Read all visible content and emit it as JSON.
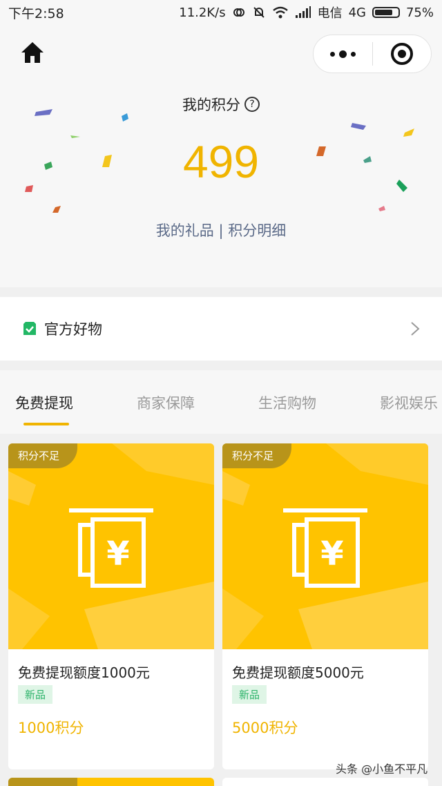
{
  "status_bar": {
    "time": "下午2:58",
    "speed": "11.2K/s",
    "carrier": "电信",
    "network": "4G",
    "battery": "75%"
  },
  "header": {
    "home_icon": "home-icon",
    "more_icon": "more-dots-icon",
    "close_icon": "target-circle-icon",
    "points_title": "我的积分",
    "points_value": "499",
    "links": {
      "gifts": "我的礼品",
      "separator": "|",
      "details": "积分明细"
    }
  },
  "official": {
    "label": "官方好物",
    "icon": "green-bag-icon",
    "chevron": "chevron-right-icon"
  },
  "tabs": [
    {
      "label": "免费提现",
      "active": true
    },
    {
      "label": "商家保障",
      "active": false
    },
    {
      "label": "生活购物",
      "active": false
    },
    {
      "label": "影视娱乐",
      "active": false
    }
  ],
  "cards": [
    {
      "badge": "积分不足",
      "title": "免费提现额度1000元",
      "tag": "新品",
      "price": "1000积分"
    },
    {
      "badge": "积分不足",
      "title": "免费提现额度5000元",
      "tag": "新品",
      "price": "5000积分"
    }
  ],
  "watermark": "头条 @小鱼不平凡",
  "colors": {
    "accent": "#f0b400",
    "card_yellow": "#ffc300",
    "link": "#5b6a88",
    "tag_green": "#2db36a"
  }
}
